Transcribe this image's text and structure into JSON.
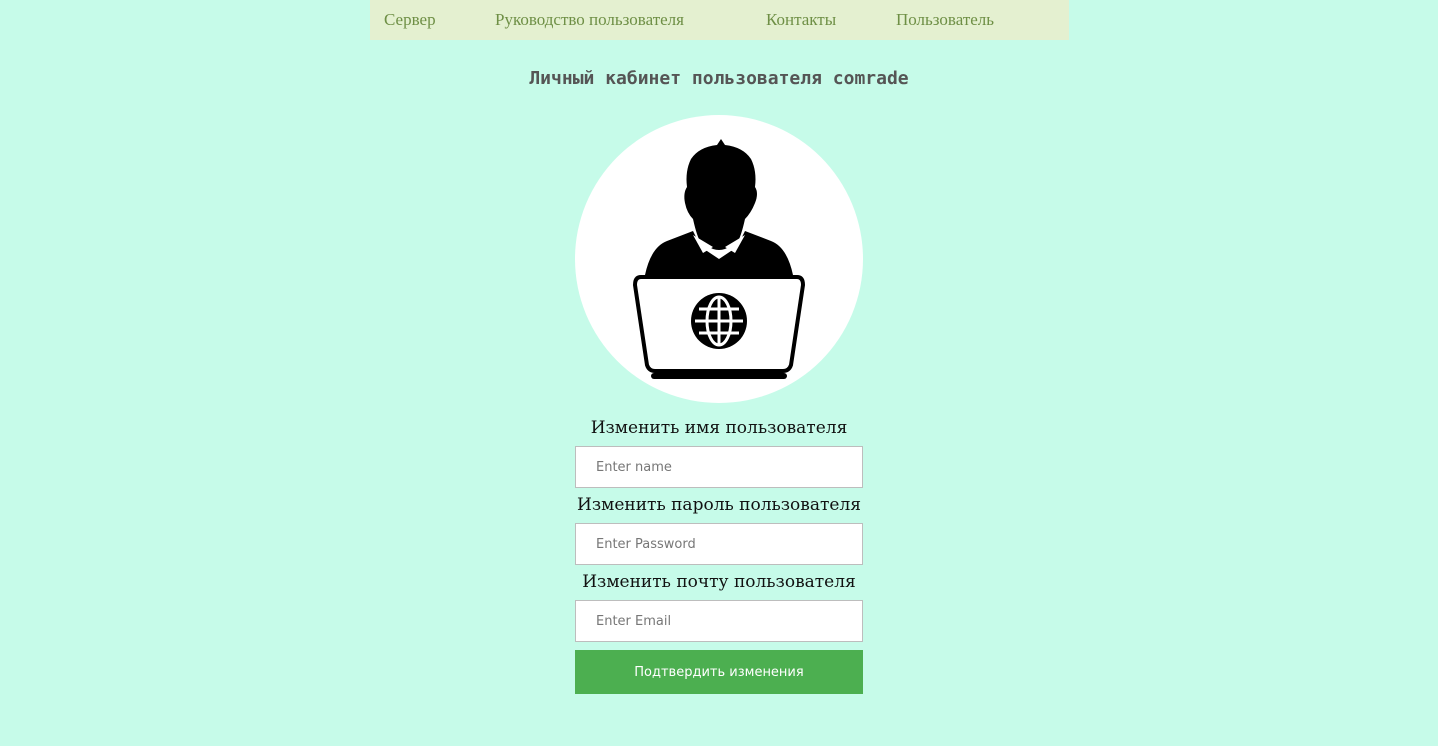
{
  "nav": {
    "items": [
      {
        "label": "Сервер"
      },
      {
        "label": "Руководство пользователя"
      },
      {
        "label": "Контакты"
      },
      {
        "label": "Пользователь"
      }
    ]
  },
  "page": {
    "title": "Личный кабинет пользователя comrade"
  },
  "avatar": {
    "icon": "user-laptop-globe-icon"
  },
  "form": {
    "name_label": "Изменить имя пользователя",
    "name_placeholder": "Enter name",
    "password_label": "Изменить пароль пользователя",
    "password_placeholder": "Enter Password",
    "email_label": "Изменить почту пользователя",
    "email_placeholder": "Enter Email",
    "submit_label": "Подтвердить изменения"
  },
  "colors": {
    "background": "#c6fbe9",
    "nav_background": "#e4f0d0",
    "nav_text": "#6e8f45",
    "button": "#4caf50"
  }
}
